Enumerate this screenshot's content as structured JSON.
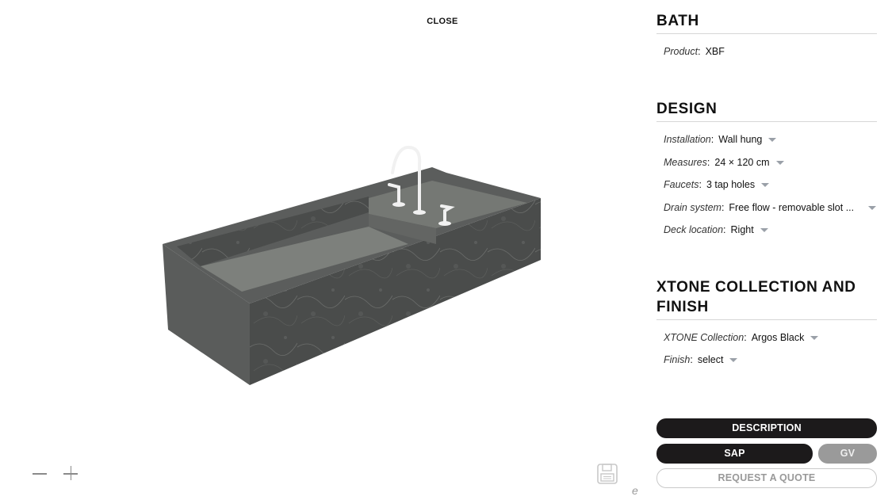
{
  "viewer": {
    "close_label": "CLOSE",
    "product_image_alt": "XBF wall hung washbasin with deck, Argos Black XTONE, 3 tap holes",
    "zoom_out_icon": "minus-icon",
    "zoom_in_icon": "plus-icon",
    "save_icon": "floppy-disk-icon",
    "logo_glyph": "e"
  },
  "sections": {
    "bath": {
      "title": "BATH",
      "fields": [
        {
          "label": "Product",
          "value": "XBF",
          "selectable": false
        }
      ]
    },
    "design": {
      "title": "DESIGN",
      "fields": [
        {
          "label": "Installation",
          "value": "Wall hung",
          "selectable": true
        },
        {
          "label": "Measures",
          "value": "24 × 120 cm",
          "selectable": true
        },
        {
          "label": "Faucets",
          "value": "3 tap holes",
          "selectable": true
        },
        {
          "label": "Drain system",
          "value": "Free flow - removable slot ...",
          "selectable": true
        },
        {
          "label": "Deck location",
          "value": "Right",
          "selectable": true
        }
      ]
    },
    "collection": {
      "title_line1": "XTONE COLLECTION AND",
      "title_line2": "FINISH",
      "fields": [
        {
          "label": "XTONE Collection",
          "value": "Argos Black",
          "selectable": true
        },
        {
          "label": "Finish",
          "value": "select",
          "selectable": true
        }
      ]
    }
  },
  "separator": ":",
  "actions": {
    "description": "DESCRIPTION",
    "sap": "SAP",
    "gv": "GV",
    "request_quote": "REQUEST A QUOTE"
  },
  "colors": {
    "primary_button": "#1c1a1b",
    "secondary_button": "#9a9a9a",
    "dropdown_arrow": "#9aa0a8",
    "divider": "#d6d6d6"
  }
}
